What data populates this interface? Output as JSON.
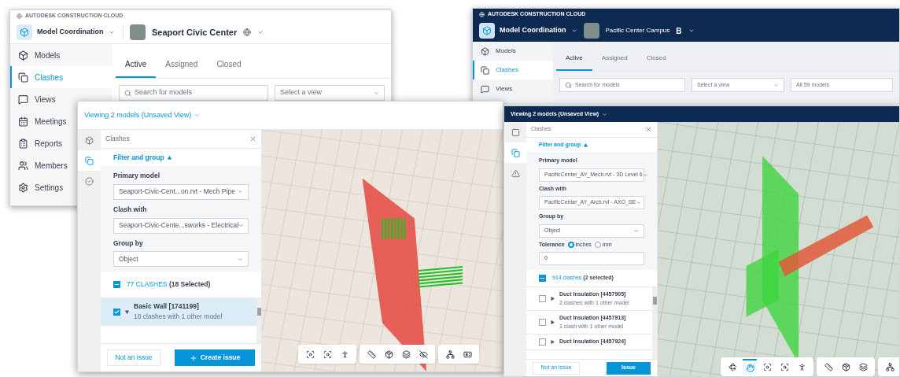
{
  "app_windows": [
    {
      "kind": "classic",
      "brand": "AUTODESK CONSTRUCTION CLOUD",
      "module": "Model Coordination",
      "project": "Seaport Civic Center",
      "nav": [
        {
          "label": "Models",
          "selected": false
        },
        {
          "label": "Clashes",
          "selected": true
        },
        {
          "label": "Views",
          "selected": false
        },
        {
          "label": "Meetings",
          "selected": false
        },
        {
          "label": "Reports",
          "selected": false
        },
        {
          "label": "Members",
          "selected": false
        },
        {
          "label": "Settings",
          "selected": false
        }
      ],
      "tabs": [
        {
          "label": "Active",
          "selected": true
        },
        {
          "label": "Assigned",
          "selected": false
        },
        {
          "label": "Closed",
          "selected": false
        }
      ],
      "search": {
        "placeholder": "Search for models"
      },
      "view_select": {
        "placeholder": "Select a view"
      }
    },
    {
      "kind": "navy",
      "brand": "AUTODESK CONSTRUCTION CLOUD",
      "module": "Model Coordination",
      "project": "Pacific Center Campus",
      "project_badge": "B",
      "nav": [
        {
          "label": "Models",
          "selected": false
        },
        {
          "label": "Clashes",
          "selected": true
        },
        {
          "label": "Views",
          "selected": false
        }
      ],
      "tabs": [
        {
          "label": "Active",
          "selected": true
        },
        {
          "label": "Assigned",
          "selected": false
        },
        {
          "label": "Closed",
          "selected": false
        }
      ],
      "search": {
        "placeholder": "Search for models"
      },
      "view_select": {
        "placeholder": "Select a view"
      },
      "models_select": {
        "value": "All 59 models"
      }
    }
  ],
  "viewers": [
    {
      "kind": "classic",
      "title": "Viewing 2 models (Unsaved View)",
      "rail": [
        {
          "selected": false
        },
        {
          "selected": true
        },
        {
          "selected": false
        }
      ],
      "panel_title": "Clashes",
      "filter_label": "Filter and group",
      "fields": [
        {
          "label": "Primary model",
          "value": "Seaport-Civic-Cent...on.rvt - Mech Pipe"
        },
        {
          "label": "Clash with",
          "value": "Seaport-Civic-Cente...sworks - Electrical"
        },
        {
          "label": "Group by",
          "value": "Object"
        }
      ],
      "summary": {
        "count": "77 CLASHES",
        "selected_text": "(18 Selected)",
        "partial": true
      },
      "rows": [
        {
          "title": "Basic Wall [1741199]",
          "subtitle": "18 clashes with 1 other model",
          "checked": true,
          "expanded": true
        }
      ],
      "buttons": [
        {
          "label": "Not an issue",
          "kind": "secondary"
        },
        {
          "label": "Create issue",
          "kind": "primary"
        }
      ],
      "toolbar": [
        [
          {
            "selected": false
          },
          {
            "selected": false
          },
          {
            "selected": false
          }
        ],
        [
          {
            "selected": false
          },
          {
            "selected": false
          },
          {
            "selected": false
          },
          {
            "selected": false
          }
        ],
        [
          {
            "selected": false
          },
          {
            "selected": false
          }
        ]
      ]
    },
    {
      "kind": "navy",
      "title": "Viewing 2 models (Unsaved View)",
      "rail": [
        {
          "selected": false
        },
        {
          "selected": true
        },
        {
          "selected": false
        }
      ],
      "panel_title": "Clashes",
      "filter_label": "Filter and group",
      "fields": [
        {
          "label": "Primary model",
          "value": "PacificCenter_AY_Mech.rvt - 3D Level 6"
        },
        {
          "label": "Clash with",
          "value": "PacificCenter_AY_Arch.rvt - AXO_SE"
        },
        {
          "label": "Group by",
          "value": "Object"
        }
      ],
      "tolerance": {
        "label": "Tolerance",
        "options": [
          {
            "label": "inches",
            "selected": true
          },
          {
            "label": "mm",
            "selected": false
          }
        ],
        "value": "0"
      },
      "summary": {
        "count": "914 clashes",
        "selected_text": "(2 selected)",
        "partial": true
      },
      "rows": [
        {
          "title": "Duct Insulation [4457905]",
          "subtitle": "2 clashes with 1 other model",
          "checked": false,
          "expanded": false
        },
        {
          "title": "Duct Insulation [4457913]",
          "subtitle": "1 clash with 1 other model",
          "checked": false,
          "expanded": false
        },
        {
          "title": "Duct Insulation [4457924]",
          "checked": false,
          "expanded": false
        }
      ],
      "buttons": [
        {
          "label": "Not an issue",
          "kind": "secondary"
        },
        {
          "label": "Issue",
          "kind": "primary"
        }
      ],
      "toolbar": [
        [
          {
            "selected": false
          },
          {
            "selected": true
          },
          {
            "selected": false
          },
          {
            "selected": false
          },
          {
            "selected": false
          }
        ],
        [
          {
            "selected": false
          },
          {
            "selected": false
          },
          {
            "selected": false
          }
        ],
        [
          {
            "selected": false
          }
        ]
      ]
    }
  ]
}
